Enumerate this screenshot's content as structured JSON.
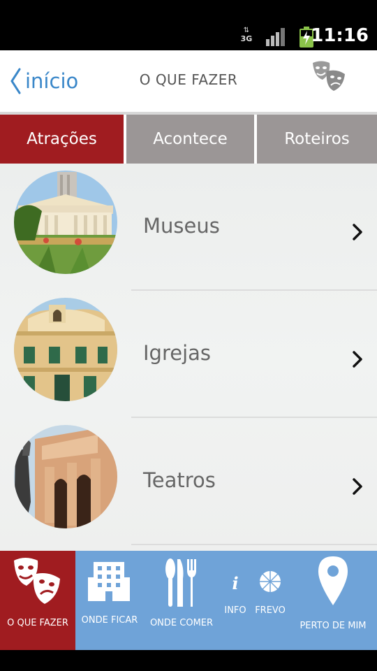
{
  "status_bar": {
    "network": "3G",
    "time": "11:16"
  },
  "header": {
    "back_label": "início",
    "title": "O QUE FAZER"
  },
  "tabs": [
    {
      "label": "Atrações",
      "active": true
    },
    {
      "label": "Acontece",
      "active": false
    },
    {
      "label": "Roteiros",
      "active": false
    }
  ],
  "list": [
    {
      "label": "Museus"
    },
    {
      "label": "Igrejas"
    },
    {
      "label": "Teatros"
    }
  ],
  "bottom_nav": [
    {
      "label": "O QUE FAZER",
      "icon": "theater-masks-icon",
      "active": true
    },
    {
      "label": "ONDE FICAR",
      "icon": "building-icon",
      "active": false
    },
    {
      "label": "ONDE COMER",
      "icon": "cutlery-icon",
      "active": false
    },
    {
      "label": "INFO",
      "icon": "info-icon",
      "active": false
    },
    {
      "label": "FREVO",
      "icon": "umbrella-icon",
      "active": false
    },
    {
      "label": "PERTO DE MIM",
      "icon": "location-pin-icon",
      "active": false
    }
  ],
  "colors": {
    "accent_red": "#a01c20",
    "tab_gray": "#9b9696",
    "nav_blue": "#6fa3d8",
    "link_blue": "#3a87c9"
  }
}
